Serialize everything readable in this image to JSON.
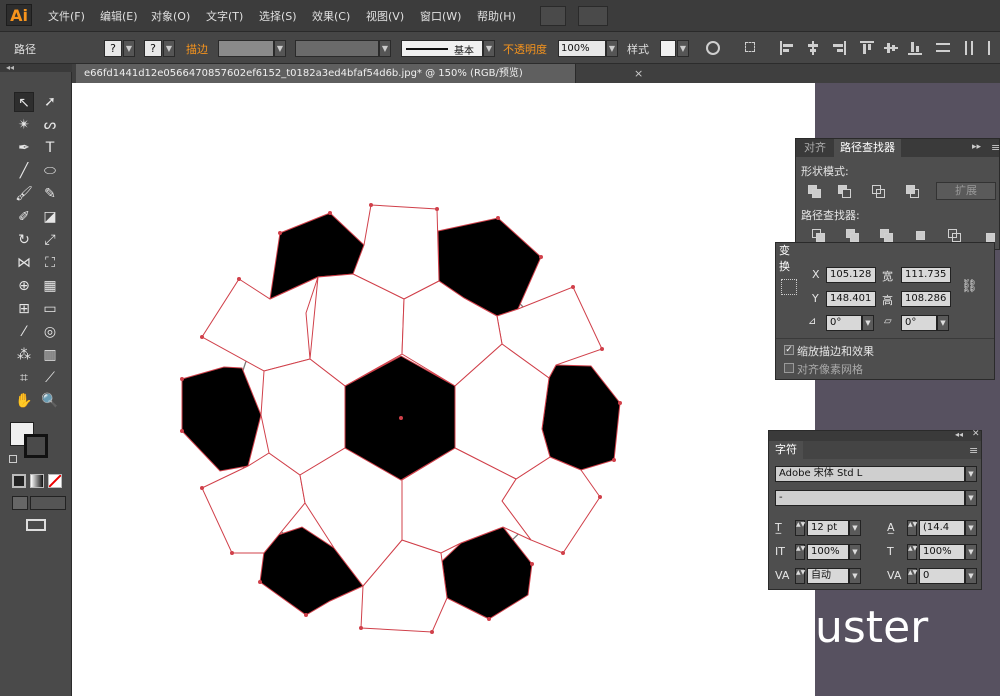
{
  "app": {
    "logo": "Ai",
    "menus": [
      "文件(F)",
      "编辑(E)",
      "对象(O)",
      "文字(T)",
      "选择(S)",
      "效果(C)",
      "视图(V)",
      "窗口(W)",
      "帮助(H)"
    ]
  },
  "control_bar": {
    "selection_label": "路径",
    "fill_value": "?",
    "stroke_value": "?",
    "stroke_label": "描边",
    "stroke_style": "基本",
    "opacity_label": "不透明度",
    "opacity_value": "100%",
    "style_label": "样式"
  },
  "document": {
    "tab_title": "e66fd1441d12e0566470857602ef6152_t0182a3ed4bfaf54d6b.jpg* @ 150% (RGB/预览)",
    "close_glyph": "×"
  },
  "pathfinder_panel": {
    "tabs": [
      "对齐",
      "路径查找器"
    ],
    "shape_modes_label": "形状模式:",
    "expand_label": "扩展",
    "pathfinders_label": "路径查找器:"
  },
  "transform_panel": {
    "tab": "变换",
    "x_label": "X",
    "x_value": "105.128",
    "w_label": "宽",
    "w_value": "111.735",
    "y_label": "Y",
    "y_value": "148.401",
    "h_label": "高",
    "h_value": "108.286",
    "rotate_value": "0°",
    "shear_value": "0°",
    "scale_strokes_label": "缩放描边和效果",
    "scale_strokes_checked": true,
    "align_pixel_label": "对齐像素网格",
    "align_pixel_checked": false
  },
  "character_panel": {
    "tab": "字符",
    "font_family": "Adobe 宋体 Std L",
    "font_style": "-",
    "font_size": "12 pt",
    "leading": "(14.4",
    "vertical_scale": "100%",
    "horizontal_scale": "100%",
    "kerning": "自动",
    "tracking": "0"
  },
  "watermark": "uster",
  "colors": {
    "accent_orange": "#f7941d",
    "path_red": "#d0404a",
    "fill_black": "#000000"
  }
}
